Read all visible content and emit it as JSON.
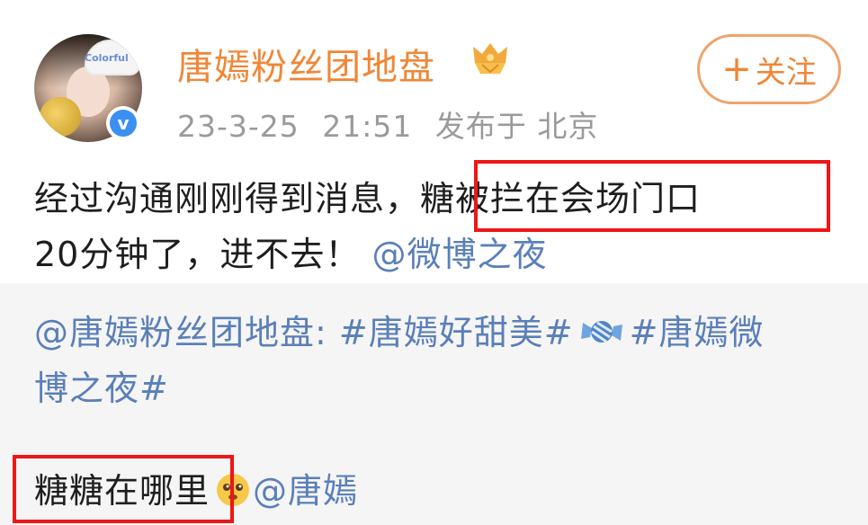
{
  "header": {
    "username": "唐嫣粉丝团地盘",
    "badge_icon": "fan-group-badge-icon",
    "avatar_hat_text": "Colorful",
    "verified_icon": "verified-v-icon",
    "verified_mark": "v",
    "date": "23-3-25",
    "time": "21:51",
    "published_from": "发布于 北京",
    "follow_button": {
      "plus": "+",
      "label": "关注"
    }
  },
  "post": {
    "line1_before": "经过沟通刚刚得到消息，",
    "line1_highlight": "糖被拦在会场门口",
    "line2_text": "20分钟了，进不去！",
    "line2_mention": "@微博之夜"
  },
  "repost": {
    "line1_author": "@唐嫣粉丝团地盘:",
    "line1_hashtag1": "#唐嫣好甜美#",
    "candy_icon": "candy-icon",
    "line1_hashtag2_part": "#唐嫣微",
    "line2_hashtag2_part": "博之夜#",
    "comment_highlight": "糖糖在哪里",
    "comment_emoji": "sad-face-emoji-icon",
    "comment_mention": "@唐嫣"
  },
  "colors": {
    "username": "#f08636",
    "link": "#5a7fb8",
    "meta": "#9a9a9a",
    "highlight_box": "#ee1616",
    "repost_bg": "#f5f5f5",
    "follow_border": "#f0a36a",
    "verified": "#3b8ff0"
  }
}
